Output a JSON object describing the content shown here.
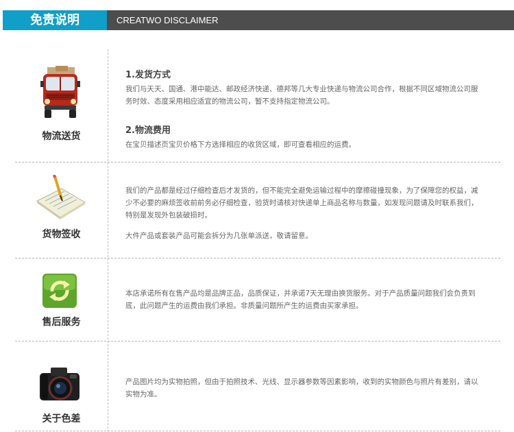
{
  "header": {
    "tag": "免责说明",
    "subtitle": "CREATWO DISCLAIMER"
  },
  "sections": [
    {
      "caption": "物流送货",
      "icon": "delivery-truck-icon",
      "blocks": [
        {
          "heading": "1.发货方式",
          "text": "我们与天天、国通、港中能达、邮政经济快递、德邦等几大专业快递与物流公司合作，根据不同区域物流公司服务时效、态度采用相应适宜的物流公司，暂不支持指定物流公司。"
        },
        {
          "heading": "2.物流费用",
          "text": "在宝贝描述页宝贝价格下方选择相应的收货区域，即可查看相应的运费。"
        }
      ]
    },
    {
      "caption": "货物签收",
      "icon": "clipboard-pencil-icon",
      "paragraphs": [
        "我们的产品都是经过仔细检查后才发货的，但不能完全避免运输过程中的摩擦碰撞现象，为了保障您的权益，减少不必要的麻烦签收前前务必仔细检查，验货时请核对快递单上商品名称与数量，如发现问题请及时联系我们，特别是发现外包装破损时。",
        "大件产品或套装产品可能会拆分为几张单派送，敬请留意。"
      ]
    },
    {
      "caption": "售后服务",
      "icon": "refresh-cycle-icon",
      "paragraphs": [
        "本店承诺所有在售产品均是品牌正品，品质保证，并承诺7天无理由换货服务。对于产品质量问题我们会负责到底，此问题产生的运费由我们承担。非质量问题所产生的运费由买家承担。"
      ]
    },
    {
      "caption": "关于色差",
      "icon": "camera-icon",
      "paragraphs": [
        "产品图片均为实物拍照，但由于拍照技术、光线、显示器参数等因素影响，收到的实物颜色与照片有差别，请以实物为准。"
      ]
    }
  ],
  "colors": {
    "accent": "#0f9fc9",
    "header_bar": "#4d4d4d",
    "text": "#666666",
    "divider": "#b5b5b5"
  }
}
